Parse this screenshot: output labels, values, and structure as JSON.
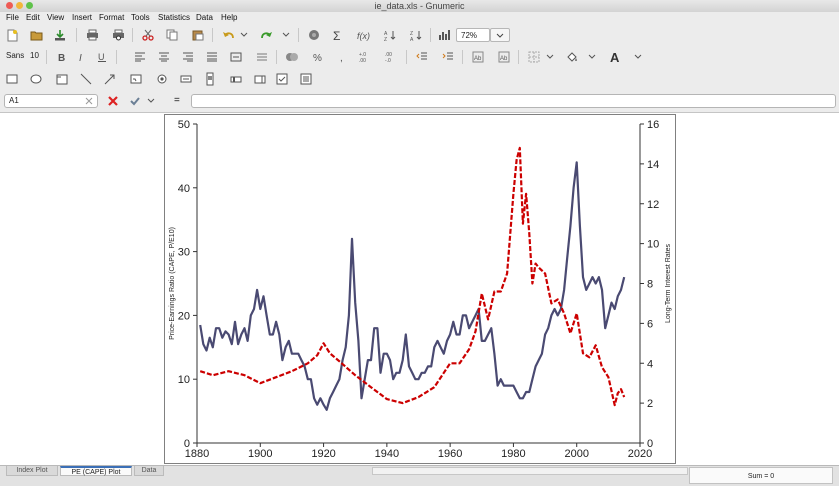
{
  "window": {
    "title": "ie_data.xls - Gnumeric"
  },
  "menu": [
    "File",
    "Edit",
    "View",
    "Insert",
    "Format",
    "Tools",
    "Statistics",
    "Data",
    "Help"
  ],
  "toolbar": {
    "zoom": "72%",
    "font_name": "Sans",
    "font_size": "10"
  },
  "formula_bar": {
    "cell_ref": "A1",
    "equals": "=",
    "content": ""
  },
  "tabs": [
    "Index Plot",
    "PE (CAPE) Plot",
    "Data"
  ],
  "active_tab": "PE (CAPE) Plot",
  "status": {
    "sum": "Sum = 0"
  },
  "icons": [
    "new-file-icon",
    "open-file-icon",
    "save-icon",
    "print-icon",
    "print-preview-icon",
    "cut-icon",
    "copy-icon",
    "paste-icon",
    "undo-icon",
    "redo-icon",
    "hyperlink-icon",
    "sum-icon",
    "function-icon",
    "sort-ascending-icon",
    "sort-descending-icon",
    "chart-icon",
    "bold-icon",
    "italic-icon",
    "underline-icon",
    "align-left-icon",
    "align-center-icon",
    "align-right-icon",
    "merge-center-icon",
    "currency-icon",
    "percent-icon",
    "thousands-icon",
    "increase-decimals-icon",
    "decrease-decimals-icon",
    "decrease-indent-icon",
    "increase-indent-icon",
    "borders-icon",
    "fill-color-icon",
    "font-color-icon",
    "rectangle-tool-icon",
    "ellipse-tool-icon",
    "frame-tool-icon",
    "line-tool-icon",
    "arrow-tool-icon",
    "button-tool-icon",
    "radio-tool-icon",
    "label-tool-icon",
    "scrollbar-tool-icon",
    "slider-tool-icon",
    "spinner-tool-icon",
    "checkbox-tool-icon",
    "combo-tool-icon",
    "list-tool-icon",
    "cancel-icon",
    "accept-icon"
  ],
  "colors": {
    "pe_series": "#4a4a72",
    "rate_series": "#cc0000"
  },
  "chart_data": {
    "type": "line",
    "xlabel": "",
    "ylabel": "Price-Earnings Ratio (CAPE, P/E10)",
    "y2label": "Long-Term Interest Rates",
    "xlim": [
      1880,
      2020
    ],
    "ylim": [
      0,
      50
    ],
    "y2lim": [
      0,
      16
    ],
    "x_ticks": [
      "1880",
      "1900",
      "1920",
      "1940",
      "1960",
      "1980",
      "2000",
      "2020"
    ],
    "y_ticks": [
      "0",
      "10",
      "20",
      "30",
      "40",
      "50"
    ],
    "y2_ticks": [
      "0",
      "2",
      "4",
      "6",
      "8",
      "10",
      "12",
      "14",
      "16"
    ],
    "grid": false,
    "series": [
      {
        "axis": "left",
        "style": "solid",
        "x": [
          1881,
          1882,
          1883,
          1884,
          1885,
          1886,
          1887,
          1888,
          1889,
          1890,
          1891,
          1892,
          1893,
          1894,
          1895,
          1896,
          1897,
          1898,
          1899,
          1900,
          1901,
          1902,
          1903,
          1904,
          1905,
          1906,
          1907,
          1908,
          1909,
          1910,
          1911,
          1912,
          1913,
          1914,
          1915,
          1916,
          1917,
          1918,
          1919,
          1920,
          1921,
          1922,
          1923,
          1924,
          1925,
          1926,
          1927,
          1928,
          1929,
          1930,
          1931,
          1932,
          1933,
          1934,
          1935,
          1936,
          1937,
          1938,
          1939,
          1940,
          1941,
          1942,
          1943,
          1944,
          1945,
          1946,
          1947,
          1948,
          1949,
          1950,
          1951,
          1952,
          1953,
          1954,
          1955,
          1956,
          1957,
          1958,
          1959,
          1960,
          1961,
          1962,
          1963,
          1964,
          1965,
          1966,
          1967,
          1968,
          1969,
          1970,
          1971,
          1972,
          1973,
          1974,
          1975,
          1976,
          1977,
          1978,
          1979,
          1980,
          1981,
          1982,
          1983,
          1984,
          1985,
          1986,
          1987,
          1988,
          1989,
          1990,
          1991,
          1992,
          1993,
          1994,
          1995,
          1996,
          1997,
          1998,
          1999,
          2000,
          2001,
          2002,
          2003,
          2004,
          2005,
          2006,
          2007,
          2008,
          2009,
          2010,
          2011,
          2012,
          2013,
          2014,
          2015
        ],
        "y": [
          18.5,
          15.5,
          14.5,
          16.5,
          15,
          18,
          18,
          16.5,
          17.5,
          17,
          15.5,
          19,
          15.5,
          17,
          18,
          16,
          20,
          21,
          24,
          21,
          23,
          20,
          17,
          17,
          19,
          17,
          13,
          15,
          16,
          14,
          14,
          14,
          13,
          12,
          10,
          10,
          7,
          6,
          7,
          6,
          5.2,
          7,
          8,
          9,
          10,
          13,
          15,
          20,
          32,
          22,
          16,
          7,
          10,
          13,
          13,
          18,
          18,
          11,
          14,
          14,
          13,
          10,
          11,
          11,
          13,
          17,
          12,
          11,
          10,
          10,
          11,
          11,
          12,
          12,
          15,
          16,
          15,
          14,
          16,
          17,
          19,
          17,
          17,
          20,
          20,
          18,
          19,
          20,
          21,
          16,
          16,
          17,
          18,
          14,
          9,
          10,
          9,
          9,
          9,
          9,
          8,
          7,
          7,
          8,
          8,
          10,
          12,
          13,
          14,
          17,
          18,
          20,
          21,
          20,
          21,
          24,
          29,
          34,
          40,
          44,
          34,
          26,
          24,
          25,
          26,
          25,
          26,
          24,
          18,
          20,
          22,
          21,
          23,
          24,
          26
        ]
      },
      {
        "axis": "right",
        "style": "dashed",
        "x": [
          1881,
          1885,
          1890,
          1895,
          1900,
          1905,
          1910,
          1915,
          1918,
          1920,
          1922,
          1925,
          1930,
          1935,
          1940,
          1945,
          1950,
          1955,
          1960,
          1963,
          1966,
          1968,
          1970,
          1972,
          1974,
          1976,
          1978,
          1980,
          1981,
          1982,
          1983,
          1984,
          1985,
          1986,
          1987,
          1988,
          1990,
          1992,
          1994,
          1996,
          1998,
          2000,
          2002,
          2004,
          2006,
          2008,
          2010,
          2012,
          2013,
          2014,
          2015
        ],
        "y": [
          3.6,
          3.4,
          3.6,
          3.4,
          3.0,
          3.3,
          3.6,
          4.0,
          4.4,
          5.0,
          4.5,
          4.1,
          3.4,
          2.8,
          2.2,
          2.0,
          2.3,
          2.8,
          4.0,
          4.0,
          4.7,
          5.6,
          7.5,
          6.2,
          7.6,
          7.6,
          8.5,
          12.5,
          14.2,
          14.8,
          11.0,
          12.5,
          10.5,
          8.0,
          9.0,
          8.8,
          8.5,
          7.0,
          7.2,
          6.5,
          5.5,
          6.5,
          4.5,
          4.3,
          4.9,
          3.8,
          3.3,
          1.9,
          2.5,
          2.7,
          2.3
        ]
      }
    ]
  }
}
